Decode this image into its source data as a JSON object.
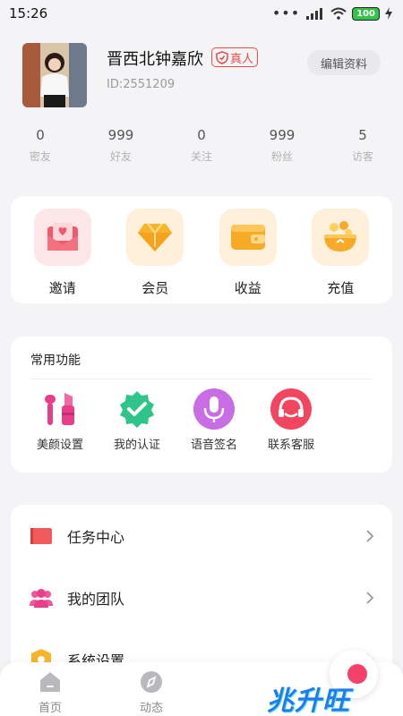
{
  "status_bar": {
    "time": "15:26",
    "battery": "100"
  },
  "profile": {
    "nickname": "晋西北钟嘉欣",
    "badge": "真人",
    "id": "ID:2551209",
    "edit_label": "编辑资料"
  },
  "stats": [
    {
      "value": "0",
      "label": "密友"
    },
    {
      "value": "999",
      "label": "好友"
    },
    {
      "value": "0",
      "label": "关注"
    },
    {
      "value": "999",
      "label": "粉丝"
    },
    {
      "value": "5",
      "label": "访客"
    }
  ],
  "quick_actions": [
    {
      "label": "邀请",
      "icon": "invite-envelope-icon"
    },
    {
      "label": "会员",
      "icon": "diamond-icon"
    },
    {
      "label": "收益",
      "icon": "wallet-icon"
    },
    {
      "label": "充值",
      "icon": "coin-bowl-icon"
    }
  ],
  "common_functions": {
    "title": "常用功能",
    "items": [
      {
        "label": "美颜设置",
        "icon": "lipstick-icon"
      },
      {
        "label": "我的认证",
        "icon": "verified-badge-icon"
      },
      {
        "label": "语音签名",
        "icon": "microphone-icon"
      },
      {
        "label": "联系客服",
        "icon": "headset-icon"
      }
    ]
  },
  "menu": [
    {
      "label": "任务中心",
      "icon": "flag-icon"
    },
    {
      "label": "我的团队",
      "icon": "team-icon"
    },
    {
      "label": "系统设置",
      "icon": "settings-shield-icon"
    }
  ],
  "tabbar": [
    {
      "label": "首页",
      "icon": "home-icon"
    },
    {
      "label": "动态",
      "icon": "compass-icon"
    }
  ],
  "watermark": "兆升旺",
  "colors": {
    "accent_red": "#e94a4a",
    "pink": "#f2426a",
    "green": "#2fc58a",
    "purple": "#c86de3",
    "orange": "#f7a928"
  }
}
